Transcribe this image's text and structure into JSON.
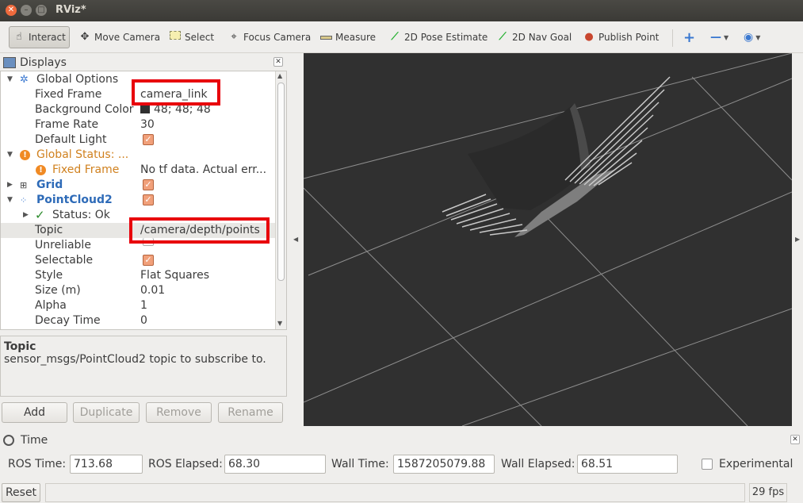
{
  "window": {
    "title": "RViz*"
  },
  "toolbar": {
    "tools": [
      {
        "label": "Interact",
        "icon": "hand-cursor-icon"
      },
      {
        "label": "Move Camera",
        "icon": "move-arrows-icon"
      },
      {
        "label": "Select",
        "icon": "select-rect-icon"
      },
      {
        "label": "Focus Camera",
        "icon": "crosshair-icon"
      },
      {
        "label": "Measure",
        "icon": "ruler-icon"
      },
      {
        "label": "2D Pose Estimate",
        "icon": "green-arrow-icon"
      },
      {
        "label": "2D Nav Goal",
        "icon": "green-arrow-icon"
      },
      {
        "label": "Publish Point",
        "icon": "map-pin-icon"
      }
    ]
  },
  "displays": {
    "title": "Displays",
    "global_options": "Global Options",
    "fixed_frame_label": "Fixed Frame",
    "fixed_frame_value": "camera_link",
    "bg_color_label": "Background Color",
    "bg_color_value": "48; 48; 48",
    "frame_rate_label": "Frame Rate",
    "frame_rate_value": "30",
    "default_light_label": "Default Light",
    "global_status_label": "Global Status: ...",
    "fixed_frame_err_label": "Fixed Frame",
    "fixed_frame_err_value": "No tf data.  Actual err...",
    "grid_label": "Grid",
    "pointcloud_label": "PointCloud2",
    "status_ok_label": "Status: Ok",
    "topic_label": "Topic",
    "topic_value": "/camera/depth/points",
    "unreliable_label": "Unreliable",
    "selectable_label": "Selectable",
    "style_label": "Style",
    "style_value": "Flat Squares",
    "size_label": "Size (m)",
    "size_value": "0.01",
    "alpha_label": "Alpha",
    "alpha_value": "1",
    "decay_label": "Decay Time",
    "decay_value": "0"
  },
  "description": {
    "title": "Topic",
    "text": "sensor_msgs/PointCloud2 topic to subscribe to."
  },
  "buttons": {
    "add": "Add",
    "duplicate": "Duplicate",
    "remove": "Remove",
    "rename": "Rename"
  },
  "time": {
    "title": "Time",
    "ros_time_label": "ROS Time:",
    "ros_time_value": "713.68",
    "ros_elapsed_label": "ROS Elapsed:",
    "ros_elapsed_value": "68.30",
    "wall_time_label": "Wall Time:",
    "wall_time_value": "1587205079.88",
    "wall_elapsed_label": "Wall Elapsed:",
    "wall_elapsed_value": "68.51",
    "experimental_label": "Experimental"
  },
  "status": {
    "reset_label": "Reset",
    "fps": "29 fps"
  },
  "colors": {
    "view_bg": "#303030",
    "highlight": "#e8000b",
    "checkbox": "#f1a07a"
  }
}
